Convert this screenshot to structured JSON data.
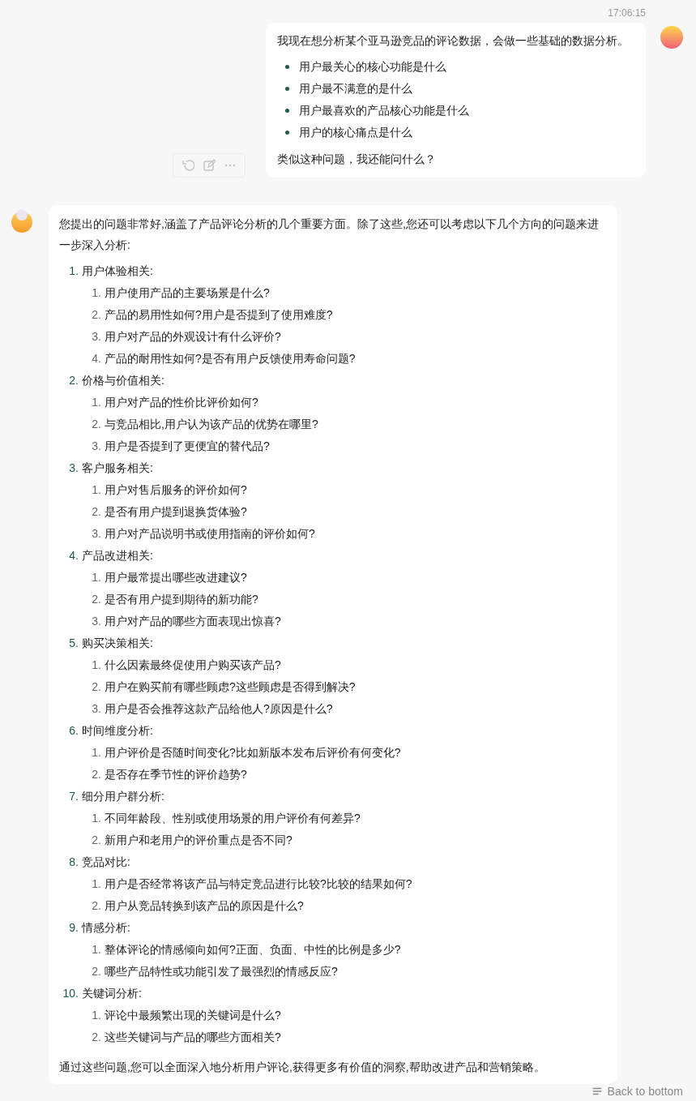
{
  "user_message": {
    "time": "17:06:15",
    "intro": "我现在想分析某个亚马逊竞品的评论数据，会做一些基础的数据分析。",
    "bullets": [
      "用户最关心的核心功能是什么",
      "用户最不满意的是什么",
      "用户最喜欢的产品核心功能是什么",
      "用户的核心痛点是什么"
    ],
    "outro": "类似这种问题，我还能问什么？"
  },
  "assistant_message": {
    "intro": "您提出的问题非常好,涵盖了产品评论分析的几个重要方面。除了这些,您还可以考虑以下几个方向的问题来进一步深入分析:",
    "sections": [
      {
        "number": "1.",
        "title": "用户体验相关:",
        "children": [
          {
            "number": "1.",
            "text": "用户使用产品的主要场景是什么?"
          },
          {
            "number": "2.",
            "text": "产品的易用性如何?用户是否提到了使用难度?"
          },
          {
            "number": "3.",
            "text": "用户对产品的外观设计有什么评价?"
          },
          {
            "number": "4.",
            "text": "产品的耐用性如何?是否有用户反馈使用寿命问题?"
          }
        ]
      },
      {
        "number": "2.",
        "title": "价格与价值相关:",
        "children": [
          {
            "number": "1.",
            "text": "用户对产品的性价比评价如何?"
          },
          {
            "number": "2.",
            "text": "与竞品相比,用户认为该产品的优势在哪里?"
          },
          {
            "number": "3.",
            "text": "用户是否提到了更便宜的替代品?"
          }
        ]
      },
      {
        "number": "3.",
        "title": "客户服务相关:",
        "children": [
          {
            "number": "1.",
            "text": "用户对售后服务的评价如何?"
          },
          {
            "number": "2.",
            "text": "是否有用户提到退换货体验?"
          },
          {
            "number": "3.",
            "text": "用户对产品说明书或使用指南的评价如何?"
          }
        ]
      },
      {
        "number": "4.",
        "title": "产品改进相关:",
        "children": [
          {
            "number": "1.",
            "text": "用户最常提出哪些改进建议?"
          },
          {
            "number": "2.",
            "text": "是否有用户提到期待的新功能?"
          },
          {
            "number": "3.",
            "text": "用户对产品的哪些方面表现出惊喜?"
          }
        ]
      },
      {
        "number": "5.",
        "title": "购买决策相关:",
        "children": [
          {
            "number": "1.",
            "text": "什么因素最终促使用户购买该产品?"
          },
          {
            "number": "2.",
            "text": "用户在购买前有哪些顾虑?这些顾虑是否得到解决?"
          },
          {
            "number": "3.",
            "text": "用户是否会推荐这款产品给他人?原因是什么?"
          }
        ]
      },
      {
        "number": "6.",
        "title": "时间维度分析:",
        "children": [
          {
            "number": "1.",
            "text": "用户评价是否随时间变化?比如新版本发布后评价有何变化?"
          },
          {
            "number": "2.",
            "text": "是否存在季节性的评价趋势?"
          }
        ]
      },
      {
        "number": "7.",
        "title": "细分用户群分析:",
        "children": [
          {
            "number": "1.",
            "text": "不同年龄段、性别或使用场景的用户评价有何差异?"
          },
          {
            "number": "2.",
            "text": "新用户和老用户的评价重点是否不同?"
          }
        ]
      },
      {
        "number": "8.",
        "title": "竞品对比:",
        "children": [
          {
            "number": "1.",
            "text": "用户是否经常将该产品与特定竞品进行比较?比较的结果如何?"
          },
          {
            "number": "2.",
            "text": "用户从竞品转换到该产品的原因是什么?"
          }
        ]
      },
      {
        "number": "9.",
        "title": "情感分析:",
        "children": [
          {
            "number": "1.",
            "text": "整体评论的情感倾向如何?正面、负面、中性的比例是多少?"
          },
          {
            "number": "2.",
            "text": "哪些产品特性或功能引发了最强烈的情感反应?"
          }
        ]
      },
      {
        "number": "10.",
        "title": "关键词分析:",
        "children": [
          {
            "number": "1.",
            "text": "评论中最频繁出现的关键词是什么?"
          },
          {
            "number": "2.",
            "text": "这些关键词与产品的哪些方面相关?"
          }
        ]
      }
    ],
    "outro": "通过这些问题,您可以全面深入地分析用户评论,获得更多有价值的洞察,帮助改进产品和营销策略。"
  },
  "back_to_bottom": {
    "label": "Back to bottom"
  }
}
